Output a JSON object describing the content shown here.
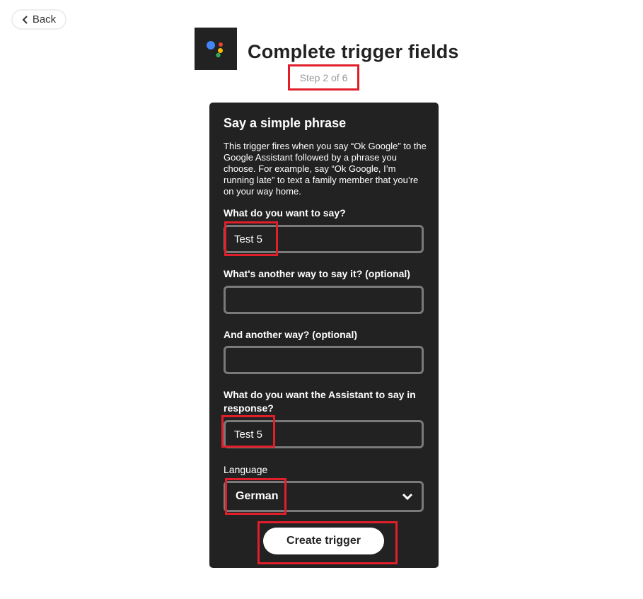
{
  "nav": {
    "back_label": "Back"
  },
  "header": {
    "title": "Complete trigger fields",
    "step": "Step 2 of 6",
    "logo_icon": "google-assistant-logo"
  },
  "trigger": {
    "title": "Say a simple phrase",
    "description": "This trigger fires when you say “Ok Google” to the Google Assistant followed by a phrase you choose. For example, say “Ok Google, I’m running late” to text a family member that you’re on your way home.",
    "fields": [
      {
        "label": "What do you want to say?",
        "value": "Test 5"
      },
      {
        "label": "What's another way to say it? (optional)",
        "value": ""
      },
      {
        "label": "And another way? (optional)",
        "value": ""
      },
      {
        "label": "What do you want the Assistant to say in response?",
        "value": "Test 5"
      }
    ],
    "language": {
      "label": "Language",
      "selected": "German"
    },
    "submit_label": "Create trigger"
  },
  "colors": {
    "card_bg": "#222222",
    "highlight": "#e01f2a",
    "field_border": "#7a7a7a",
    "google_blue": "#4285F4",
    "google_red": "#EA4335",
    "google_yellow": "#FBBC05",
    "google_green": "#34A853"
  }
}
